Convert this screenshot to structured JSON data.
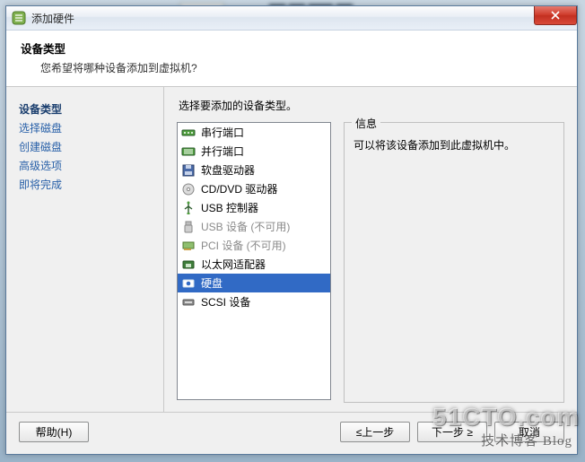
{
  "window": {
    "title": "添加硬件",
    "close_aria": "关闭"
  },
  "header": {
    "title": "设备类型",
    "subtitle": "您希望将哪种设备添加到虚拟机?"
  },
  "sidebar": {
    "items": [
      {
        "label": "设备类型",
        "state": "active"
      },
      {
        "label": "选择磁盘",
        "state": "link"
      },
      {
        "label": "创建磁盘",
        "state": "link"
      },
      {
        "label": "高级选项",
        "state": "link"
      },
      {
        "label": "即将完成",
        "state": "link"
      }
    ]
  },
  "main": {
    "instruction": "选择要添加的设备类型。",
    "devices": [
      {
        "icon": "serial-port-icon",
        "label": "串行端口",
        "state": "normal"
      },
      {
        "icon": "parallel-port-icon",
        "label": "并行端口",
        "state": "normal"
      },
      {
        "icon": "floppy-drive-icon",
        "label": "软盘驱动器",
        "state": "normal"
      },
      {
        "icon": "cd-dvd-drive-icon",
        "label": "CD/DVD 驱动器",
        "state": "normal"
      },
      {
        "icon": "usb-controller-icon",
        "label": "USB 控制器",
        "state": "normal"
      },
      {
        "icon": "usb-device-icon",
        "label": "USB 设备 (不可用)",
        "state": "disabled"
      },
      {
        "icon": "pci-device-icon",
        "label": "PCI 设备 (不可用)",
        "state": "disabled"
      },
      {
        "icon": "ethernet-adapter-icon",
        "label": "以太网适配器",
        "state": "normal"
      },
      {
        "icon": "hard-disk-icon",
        "label": "硬盘",
        "state": "selected"
      },
      {
        "icon": "scsi-device-icon",
        "label": "SCSI 设备",
        "state": "normal"
      }
    ],
    "info_legend": "信息",
    "info_text": "可以将该设备添加到此虚拟机中。"
  },
  "footer": {
    "help": "帮助(H)",
    "back": "≤上一步",
    "next": "下一步 ≥",
    "cancel": "取消"
  },
  "watermark": {
    "big": "51CTO.com",
    "small": "技术博客   Blog"
  }
}
